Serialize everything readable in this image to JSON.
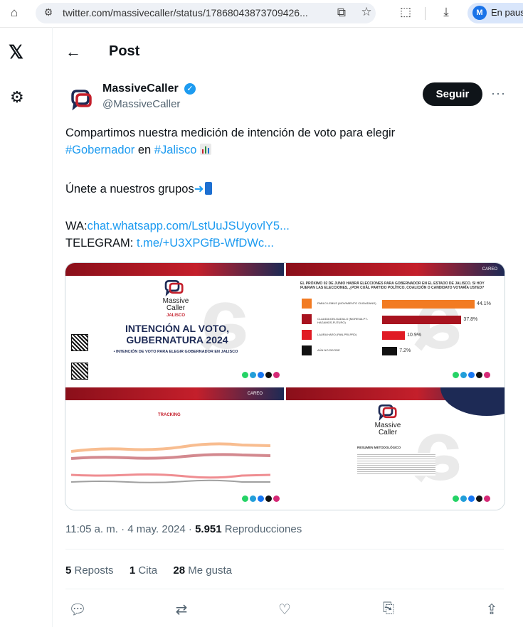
{
  "browser": {
    "url": "twitter.com/massivecaller/status/17868043873709426...",
    "profile_initial": "M",
    "profile_status": "En paus"
  },
  "header": {
    "title": "Post"
  },
  "author": {
    "name": "MassiveCaller",
    "handle": "@MassiveCaller",
    "follow_label": "Seguir"
  },
  "tweet": {
    "line1": "Compartimos nuestra medición de intención de voto para elegir",
    "hashtag1": "#Gobernador",
    "connector": " en ",
    "hashtag2": "#Jalisco",
    "line3": "Únete a nuestros grupos",
    "wa_label": "WA:",
    "wa_link": "chat.whatsapp.com/LstUuJSUyovlY5...",
    "telegram_label": "TELEGRAM: ",
    "telegram_link": "t.me/+U3XPGfB-WfDWc..."
  },
  "media": {
    "panel1": {
      "brand_line1": "Massive",
      "brand_line2": "Caller",
      "state": "JALISCO",
      "headline1": "INTENCIÓN AL VOTO,",
      "headline2": "GUBERNATURA 2024",
      "subtitle": "• INTENCIÓN DE VOTO PARA ELEGIR GOBERNADOR EN JALISCO"
    },
    "panel2": {
      "tag": "CAREO",
      "question": "EL PRÓXIMO 02 DE JUNIO HABRÁ ELECCIONES PARA GOBERNADOR EN EL ESTADO DE JALISCO. SI HOY FUERAN LAS ELECCIONES, ¿POR CUÁL PARTIDO POLÍTICO, COALICIÓN O CANDIDATO VOTARÍA USTED?",
      "results": [
        {
          "label": "PABLO LEMUS (MOVIMIENTO CIUDADANO)",
          "value": "44.1%",
          "pct": 44.1,
          "color": "#f27b22"
        },
        {
          "label": "CLAUDIA DELGADILLO (MORENA-PT-HAGAMOS-FUTURO)",
          "value": "37.8%",
          "pct": 37.8,
          "color": "#a8131f"
        },
        {
          "label": "LAURA HARO (PAN-PRI-PRD)",
          "value": "10.9%",
          "pct": 10.9,
          "color": "#e01b24"
        },
        {
          "label": "AÚN NO DECIDE",
          "value": "7.2%",
          "pct": 7.2,
          "color": "#111111"
        }
      ]
    },
    "panel3": {
      "tag": "CAREO",
      "subtitle": "TRACKING"
    },
    "panel4": {
      "brand_line1": "Massive",
      "brand_line2": "Caller",
      "heading": "RESUMEN METODOLÓGICO"
    }
  },
  "meta": {
    "time": "11:05 a. m.",
    "sep": " · ",
    "date": "4 may. 2024",
    "views": "5.951",
    "views_label": " Reproducciones"
  },
  "stats": {
    "reposts": "5",
    "reposts_label": " Reposts",
    "quotes": "1",
    "quotes_label": " Cita",
    "likes": "28",
    "likes_label": " Me gusta"
  },
  "colors": {
    "accent": "#1d9bf0",
    "text": "#0f1419",
    "muted": "#536471"
  }
}
